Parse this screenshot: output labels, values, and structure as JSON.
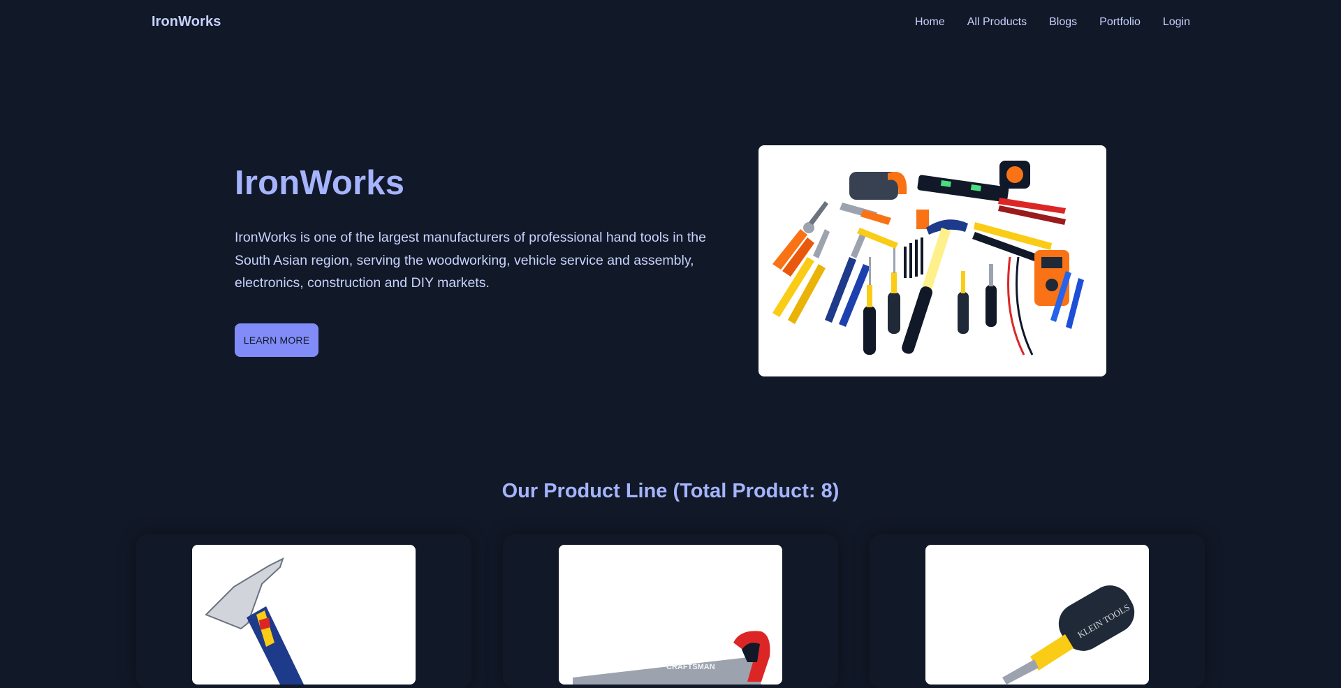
{
  "navbar": {
    "brand": "IronWorks",
    "links": [
      "Home",
      "All Products",
      "Blogs",
      "Portfolio",
      "Login"
    ]
  },
  "hero": {
    "title": "IronWorks",
    "description": "IronWorks is one of the largest manufacturers of professional hand tools in the South Asian region, serving the woodworking, vehicle service and assembly, electronics, construction and DIY markets.",
    "button_label": "LEARN MORE",
    "image_icon": "hand-tools-collection-image"
  },
  "products": {
    "title": "Our Product Line (Total Product: 8)",
    "items": [
      {
        "image_icon": "hammer-image"
      },
      {
        "image_icon": "hand-saw-image"
      },
      {
        "image_icon": "screwdriver-image"
      }
    ]
  },
  "colors": {
    "background": "#111827",
    "accent": "#818cf8",
    "heading": "#a5b4fc",
    "text": "#c7d2fe"
  }
}
